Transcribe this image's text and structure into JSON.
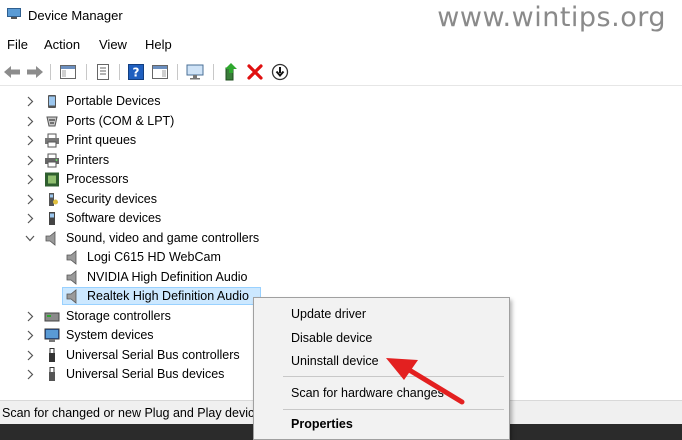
{
  "window": {
    "title": "Device Manager",
    "watermark": "www.wintips.org"
  },
  "menu": [
    "File",
    "Action",
    "View",
    "Help"
  ],
  "toolbar": {
    "icons": [
      "back-arrow-icon",
      "forward-arrow-icon",
      "console-tree-icon",
      "properties-icon",
      "help-icon",
      "action-pane-icon",
      "monitor-icon",
      "update-driver-icon",
      "uninstall-x-icon",
      "download-icon"
    ]
  },
  "tree": {
    "items": [
      {
        "label": "Portable Devices",
        "icon": "portable-device-icon",
        "expanded": false
      },
      {
        "label": "Ports (COM & LPT)",
        "icon": "port-icon",
        "expanded": false
      },
      {
        "label": "Print queues",
        "icon": "print-queue-icon",
        "expanded": false
      },
      {
        "label": "Printers",
        "icon": "printer-icon",
        "expanded": false
      },
      {
        "label": "Processors",
        "icon": "processor-icon",
        "expanded": false
      },
      {
        "label": "Security devices",
        "icon": "security-device-icon",
        "expanded": false
      },
      {
        "label": "Software devices",
        "icon": "software-device-icon",
        "expanded": false
      },
      {
        "label": "Sound, video and game controllers",
        "icon": "speaker-icon",
        "expanded": true
      },
      {
        "label": "Logi C615 HD WebCam",
        "icon": "speaker-icon",
        "child": true
      },
      {
        "label": "NVIDIA High Definition Audio",
        "icon": "speaker-icon",
        "child": true
      },
      {
        "label": "Realtek High Definition Audio",
        "icon": "speaker-icon",
        "child": true,
        "selected": true
      },
      {
        "label": "Storage controllers",
        "icon": "storage-controller-icon",
        "expanded": false
      },
      {
        "label": "System devices",
        "icon": "system-device-icon",
        "expanded": false
      },
      {
        "label": "Universal Serial Bus controllers",
        "icon": "usb-icon",
        "expanded": false
      },
      {
        "label": "Universal Serial Bus devices",
        "icon": "usb-device-icon",
        "expanded": false
      }
    ]
  },
  "context_menu": {
    "items": [
      {
        "label": "Update driver"
      },
      {
        "label": "Disable device"
      },
      {
        "label": "Uninstall device"
      },
      {
        "label": "Scan for hardware changes"
      },
      {
        "label": "Properties",
        "bold": true
      }
    ]
  },
  "status": {
    "text": "Scan for changed or new Plug and Play devices."
  },
  "colors": {
    "selection": "#cce8ff",
    "arrow": "#e32020"
  }
}
